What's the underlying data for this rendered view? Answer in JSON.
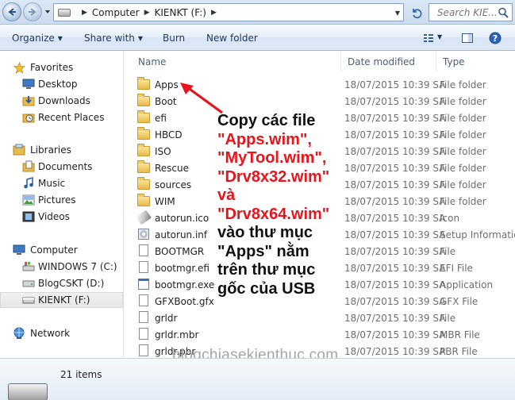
{
  "address": {
    "crumbs": [
      "Computer",
      "KIENKT (F:)"
    ],
    "search_placeholder": "Search KIE..."
  },
  "toolbar": {
    "organize": "Organize",
    "share_with": "Share with",
    "burn": "Burn",
    "new_folder": "New folder"
  },
  "nav": {
    "favorites": "Favorites",
    "desktop": "Desktop",
    "downloads": "Downloads",
    "recent_places": "Recent Places",
    "libraries": "Libraries",
    "documents": "Documents",
    "music": "Music",
    "pictures": "Pictures",
    "videos": "Videos",
    "computer": "Computer",
    "drive_c": "WINDOWS 7 (C:)",
    "drive_d": "BlogCSKT (D:)",
    "drive_f": "KIENKT (F:)",
    "network": "Network"
  },
  "columns": {
    "name": "Name",
    "date": "Date modified",
    "type": "Type"
  },
  "files": [
    {
      "name": "Apps",
      "date": "18/07/2015 10:39 SA",
      "type": "File folder",
      "icon": "folder-icon"
    },
    {
      "name": "Boot",
      "date": "18/07/2015 10:39 SA",
      "type": "File folder",
      "icon": "folder-icon"
    },
    {
      "name": "efi",
      "date": "18/07/2015 10:39 SA",
      "type": "File folder",
      "icon": "folder-icon"
    },
    {
      "name": "HBCD",
      "date": "18/07/2015 10:39 SA",
      "type": "File folder",
      "icon": "folder-icon"
    },
    {
      "name": "ISO",
      "date": "18/07/2015 10:39 SA",
      "type": "File folder",
      "icon": "folder-icon"
    },
    {
      "name": "Rescue",
      "date": "18/07/2015 10:39 SA",
      "type": "File folder",
      "icon": "folder-icon"
    },
    {
      "name": "sources",
      "date": "18/07/2015 10:39 SA",
      "type": "File folder",
      "icon": "folder-icon"
    },
    {
      "name": "WIM",
      "date": "18/07/2015 10:39 SA",
      "type": "File folder",
      "icon": "folder-icon"
    },
    {
      "name": "autorun.ico",
      "date": "18/07/2015 10:39 SA",
      "type": "Icon",
      "icon": "usb-drive-icon"
    },
    {
      "name": "autorun.inf",
      "date": "18/07/2015 10:39 SA",
      "type": "Setup Information",
      "icon": "setup-gear-icon"
    },
    {
      "name": "BOOTMGR",
      "date": "18/07/2015 10:39 SA",
      "type": "File",
      "icon": "file-icon"
    },
    {
      "name": "bootmgr.efi",
      "date": "18/07/2015 10:39 SA",
      "type": "EFI File",
      "icon": "file-icon"
    },
    {
      "name": "bootmgr.exe",
      "date": "18/07/2015 10:39 SA",
      "type": "Application",
      "icon": "application-icon"
    },
    {
      "name": "GFXBoot.gfx",
      "date": "18/07/2015 10:39 SA",
      "type": "GFX File",
      "icon": "file-icon"
    },
    {
      "name": "grldr",
      "date": "18/07/2015 10:39 SA",
      "type": "File",
      "icon": "file-icon"
    },
    {
      "name": "grldr.mbr",
      "date": "18/07/2015 10:39 SA",
      "type": "MBR File",
      "icon": "file-icon"
    },
    {
      "name": "grldr.pbr",
      "date": "18/07/2015 10:39 SA",
      "type": "PBR File",
      "icon": "file-icon"
    }
  ],
  "annotation": {
    "line1": "Copy các file",
    "file1": "\"Apps.wim\",",
    "file2": "\"MyTool.wim\",",
    "file3": "\"Drv8x32.wim\"",
    "and": "và",
    "file4": "\"Drv8x64.wim\"",
    "line6": "vào thư mục",
    "line7": "\"Apps\" nằm",
    "line8": "trên thư mục",
    "line9": "gốc của USB",
    "color": "#e8141b"
  },
  "watermark": "blogchiasekienthuc.com",
  "status": {
    "item_count": "21 items"
  }
}
